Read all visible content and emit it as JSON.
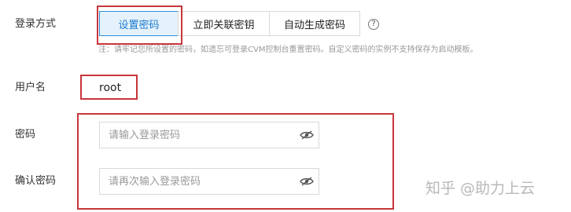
{
  "login_method": {
    "label": "登录方式",
    "options": [
      "设置密码",
      "立即关联密钥",
      "自动生成密码"
    ],
    "selected_index": 0,
    "help_glyph": "?",
    "note": "注：请牢记您所设置的密码，如遗忘可登录CVM控制台重置密码。自定义密码的实例不支持保存为启动模板。"
  },
  "username": {
    "label": "用户名",
    "value": "root"
  },
  "password": {
    "label": "密码",
    "placeholder": "请输入登录密码",
    "toggle_icon": "eye-off-icon"
  },
  "confirm_password": {
    "label": "确认密码",
    "placeholder": "请再次输入登录密码",
    "toggle_icon": "eye-off-icon"
  },
  "watermark": "知乎 @助力上云",
  "colors": {
    "accent": "#2a8ed8",
    "selected_bg": "#e6f2fb",
    "highlight_box": "#c8363c"
  }
}
